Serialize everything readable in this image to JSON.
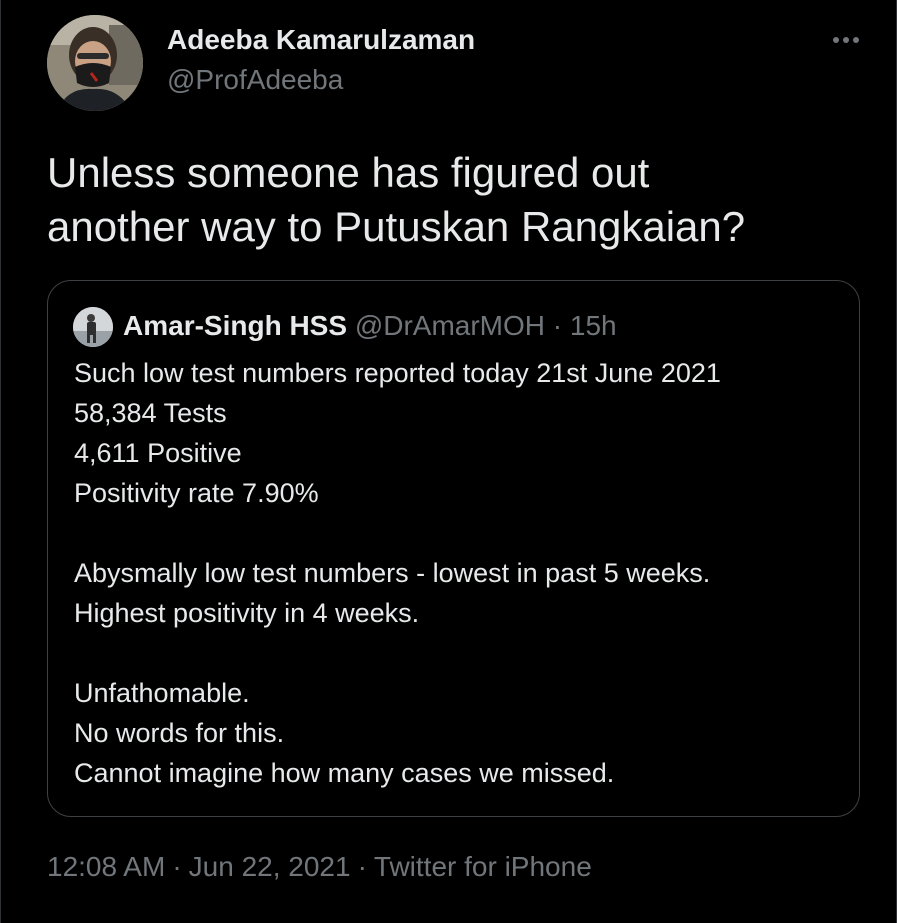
{
  "author": {
    "name": "Adeeba Kamarulzaman",
    "handle": "@ProfAdeeba",
    "avatar_icon": "profile-photo-masked-person"
  },
  "more_icon": "more-horizontal-icon",
  "tweet": {
    "lines": [
      "Unless someone has figured out",
      "another way to Putuskan Rangkaian?"
    ]
  },
  "quote": {
    "avatar_icon": "profile-photo-person-standing",
    "name": "Amar-Singh HSS",
    "handle": "@DrAmarMOH",
    "separator": "·",
    "time": "15h",
    "lines": [
      "Such low test numbers reported today 21st June 2021",
      "58,384 Tests",
      "4,611 Positive",
      "Positivity rate 7.90%",
      "",
      "Abysmally low test numbers - lowest in past 5 weeks.",
      "Highest positivity in 4 weeks.",
      "",
      "Unfathomable.",
      "No words for this.",
      "Cannot imagine how many cases we missed."
    ]
  },
  "meta": {
    "time": "12:08 AM",
    "separator": "·",
    "date": "Jun 22, 2021",
    "client": "Twitter for iPhone"
  },
  "colors": {
    "background": "#000000",
    "primary_text": "#e7e9ea",
    "secondary_text": "#71767b",
    "border": "#3e4144"
  }
}
